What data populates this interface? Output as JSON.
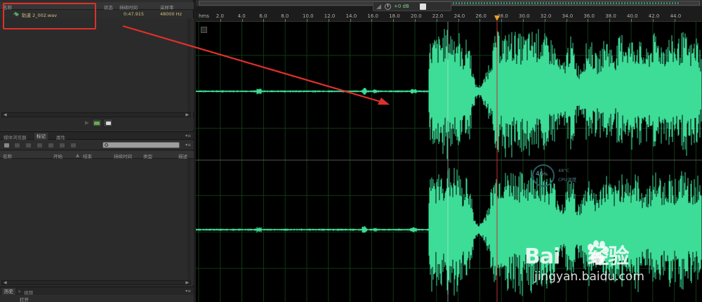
{
  "files_panel": {
    "headers": {
      "name": "名称",
      "status": "状态",
      "duration": "持续时间",
      "sample_rate": "采样率"
    },
    "file": {
      "name": "轨道 2_002.wav",
      "duration": "0:47.915",
      "sample_rate": "48000 Hz"
    }
  },
  "tabs": {
    "media_browser": "媒体浏览器",
    "markers": "标记",
    "properties": "属性"
  },
  "markers_panel": {
    "headers": {
      "name": "名称",
      "start": "开始",
      "end": "结束",
      "duration": "持续时间",
      "type": "类型",
      "description": "描述"
    }
  },
  "history_tabs": {
    "history": "历史",
    "video": "视频"
  },
  "history_item": "打开",
  "editor": {
    "volume_readout": "+0 dB",
    "ruler": {
      "unit": "hms",
      "labels": [
        "2.0",
        "4.0",
        "6.0",
        "8.0",
        "10.0",
        "12.0",
        "14.0",
        "16.0",
        "18.0",
        "20.0",
        "22.0",
        "24.0",
        "26.0",
        "28.0",
        "30.0",
        "32.0",
        "34.0",
        "36.0",
        "38.0",
        "40.0",
        "42.0",
        "44.0"
      ],
      "playhead_seconds": 27.6
    },
    "waveform_color": "#3ddc97"
  },
  "overlays": {
    "cpu_percent": "46",
    "cpu_temp": "48°C",
    "cpu_label": "CPU温度",
    "watermark_brand": "Bai",
    "watermark_suffix": "经验",
    "watermark_url": "jingyan.baidu.com"
  },
  "colors": {
    "annotation_red": "#e0302a",
    "playhead": "#e8a020",
    "grid": "#0f3a14"
  }
}
